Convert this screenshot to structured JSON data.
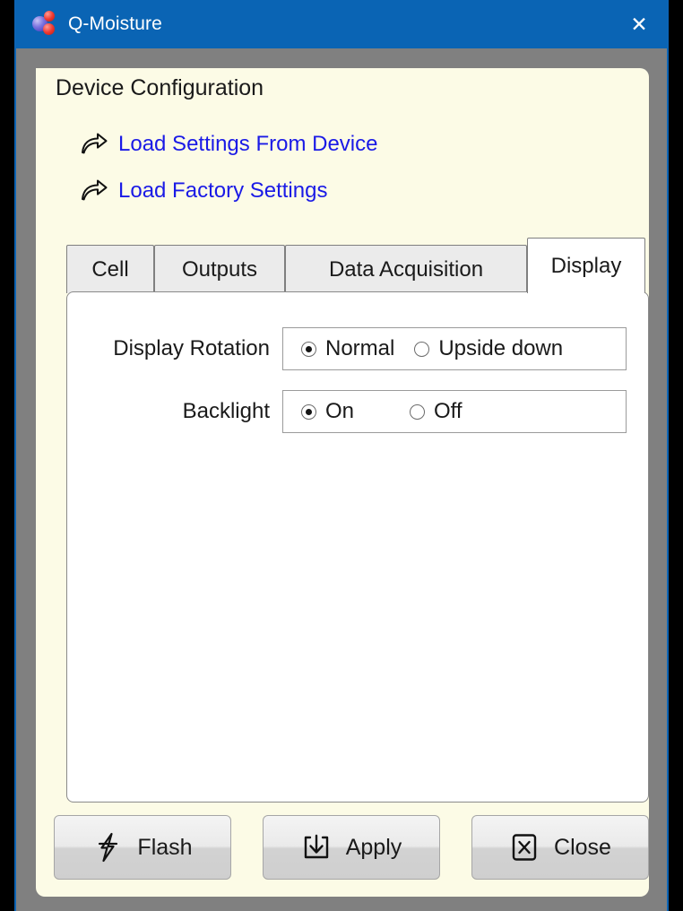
{
  "window": {
    "title": "Q-Moisture",
    "app_icon": "molecule-icon",
    "close_label": "✕"
  },
  "card": {
    "tab_title": "Device Configuration",
    "links": [
      {
        "icon": "curved-arrow-icon",
        "label": "Load Settings From Device"
      },
      {
        "icon": "curved-arrow-icon",
        "label": "Load Factory Settings"
      }
    ]
  },
  "tabs": [
    {
      "label": "Cell",
      "active": false
    },
    {
      "label": "Outputs",
      "active": false
    },
    {
      "label": "Data Acquisition",
      "active": false
    },
    {
      "label": "Display",
      "active": true
    }
  ],
  "display_tab": {
    "fields": [
      {
        "label": "Display Rotation",
        "options": [
          {
            "label": "Normal",
            "checked": true
          },
          {
            "label": "Upside down",
            "checked": false
          }
        ]
      },
      {
        "label": "Backlight",
        "options": [
          {
            "label": "On",
            "checked": true
          },
          {
            "label": "Off",
            "checked": false
          }
        ]
      }
    ]
  },
  "buttons": [
    {
      "label": "Flash",
      "icon": "lightning-bolt-icon"
    },
    {
      "label": "Apply",
      "icon": "download-tray-icon"
    },
    {
      "label": "Close",
      "icon": "x-box-icon"
    }
  ],
  "colors": {
    "titlebar": "#0a64b4",
    "card_background": "#fcfbe6",
    "link_text": "#1a1ae6",
    "window_chrome": "#808080"
  }
}
